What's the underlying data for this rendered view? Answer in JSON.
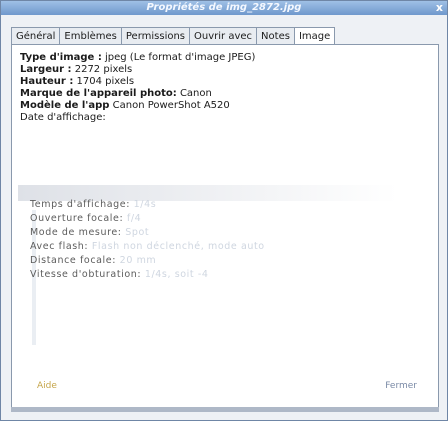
{
  "window": {
    "title": "Propriétés de img_2872.jpg",
    "close": "x"
  },
  "tabs": [
    {
      "label": "Général"
    },
    {
      "label": "Emblèmes"
    },
    {
      "label": "Permissions"
    },
    {
      "label": "Ouvrir avec"
    },
    {
      "label": "Notes"
    },
    {
      "label": "Image"
    }
  ],
  "image_info": {
    "type_label": "Type d'image :",
    "type_value": "jpeg (Le format d'image JPEG)",
    "width_label": "Largeur :",
    "width_value": "2272 pixels",
    "height_label": "Hauteur :",
    "height_value": "1704 pixels",
    "camera_make_label": "Marque de l'appareil photo:",
    "camera_make_value": "Canon",
    "camera_model_label": "Modèle de l'app",
    "camera_model_value": "Canon PowerShot A520",
    "date_label": "Date d'affichage:",
    "date_value": ""
  },
  "exif": [
    {
      "label": "Temps d'affichage:",
      "value": "1/4s"
    },
    {
      "label": "Ouverture focale:",
      "value": "f/4"
    },
    {
      "label": "Mode de mesure:",
      "value": "Spot"
    },
    {
      "label": "Avec flash:",
      "value": "Flash non déclenché, mode auto"
    },
    {
      "label": "Distance focale:",
      "value": "20 mm"
    },
    {
      "label": "Vitesse d'obturation:",
      "value": "1/4s, soit -4"
    }
  ],
  "footer": {
    "left": "Aide",
    "right": "Fermer"
  }
}
